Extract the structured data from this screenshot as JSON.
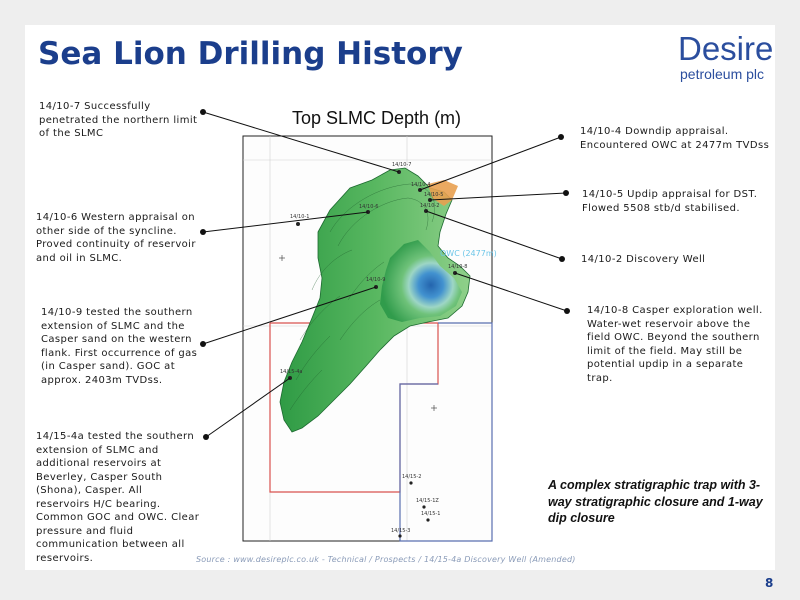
{
  "title": "Sea Lion Drilling History",
  "logo": {
    "main": "Desire",
    "sub": "petroleum plc"
  },
  "map": {
    "title": "Top SLMC Depth (m)",
    "owc_label": "OWC (2477m)",
    "wells": [
      {
        "label": "14/10-7"
      },
      {
        "label": "14/10-4"
      },
      {
        "label": "14/10-5"
      },
      {
        "label": "14/10-6"
      },
      {
        "label": "14/10-2"
      },
      {
        "label": "14/10-1"
      },
      {
        "label": "14/10-9"
      },
      {
        "label": "14/10-8"
      },
      {
        "label": "14/15-4a"
      },
      {
        "label": "14/15-2"
      },
      {
        "label": "14/15-1Z"
      },
      {
        "label": "14/15-1"
      },
      {
        "label": "14/15-3"
      }
    ]
  },
  "annotations": {
    "well_10_7": [
      "14/10-7 Successfully",
      "penetrated the northern limit",
      "of the SLMC"
    ],
    "well_10_6": [
      "14/10-6 Western appraisal on",
      "other side of the syncline.",
      "Proved continuity of reservoir",
      "and oil in SLMC."
    ],
    "well_10_9": [
      "14/10-9 tested the southern",
      "extension of SLMC and the",
      "Casper sand on the western",
      "flank. First occurrence of gas",
      "(in Casper sand).  GOC at",
      "approx. 2403m TVDss."
    ],
    "well_15_4a": [
      "14/15-4a tested the southern",
      "extension of SLMC and",
      "additional reservoirs at",
      "Beverley, Casper South",
      "(Shona), Casper.  All",
      "reservoirs H/C bearing.",
      "Common GOC and OWC.  Clear",
      "pressure and fluid",
      "communication between all",
      "reservoirs."
    ],
    "well_10_4": [
      "14/10-4 Downdip appraisal.",
      "Encountered OWC at 2477m TVDss"
    ],
    "well_10_5": [
      "14/10-5 Updip appraisal for DST.",
      "Flowed 5508 stb/d stabilised."
    ],
    "well_10_2": [
      "14/10-2 Discovery Well"
    ],
    "well_10_8": [
      "14/10-8 Casper exploration well.",
      "Water-wet reservoir above the",
      "field OWC.  Beyond the southern",
      "limit of the field.  May still be",
      "potential updip in a separate",
      "trap."
    ]
  },
  "summary": "A complex stratigraphic trap with 3-way stratigraphic closure and 1-way dip closure",
  "source": "Source : www.desireplc.co.uk - Technical / Prospects / 14/15-4a Discovery Well (Amended)",
  "page_number": "8",
  "colors": {
    "title": "#1b3e8c",
    "logo": "#2b4e9e",
    "licence_red": "#d9534f",
    "licence_blue": "#5a6fb0",
    "leader_line": "#111111",
    "owc_text": "#6ec6e8"
  }
}
